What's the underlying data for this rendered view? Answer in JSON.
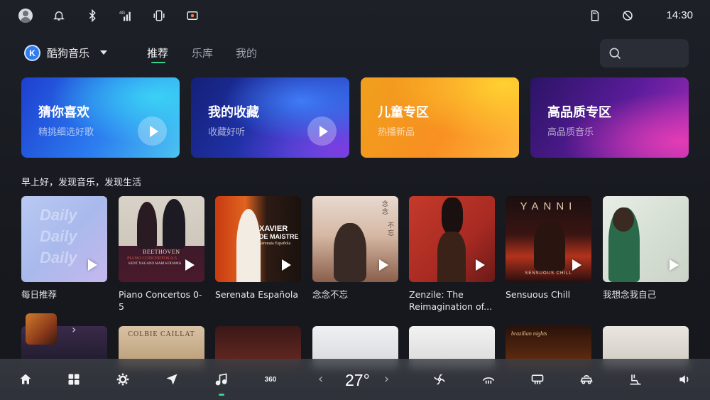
{
  "status_bar": {
    "time": "14:30",
    "icons": [
      "user-avatar",
      "bell-icon",
      "bluetooth-icon",
      "4g-signal-icon",
      "phone-vibrate-icon",
      "record-icon",
      "sd-card-icon",
      "location-off-icon"
    ]
  },
  "header": {
    "app_logo_letter": "K",
    "app_name": "酷狗音乐",
    "tabs": [
      {
        "label": "推荐",
        "active": true
      },
      {
        "label": "乐库",
        "active": false
      },
      {
        "label": "我的",
        "active": false
      }
    ],
    "search_icon": "search-icon"
  },
  "feature_cards": [
    {
      "title": "猜你喜欢",
      "subtitle": "精挑细选好歌",
      "has_play": true
    },
    {
      "title": "我的收藏",
      "subtitle": "收藏好听",
      "has_play": true
    },
    {
      "title": "儿童专区",
      "subtitle": "热播新品",
      "has_play": false
    },
    {
      "title": "高品质专区",
      "subtitle": "高品质音乐",
      "has_play": false
    }
  ],
  "section_title": "早上好，发现音乐，发现生活",
  "albums": [
    {
      "label": "每日推荐",
      "cover_text": [
        "Daily",
        "Daily",
        "Daily"
      ]
    },
    {
      "label": "Piano Concertos 0-5",
      "cover_text": [
        "BEETHOVEN",
        "PIANO CONCERTOS 0-5",
        "KENT NAGANO  MARI KODAMA"
      ]
    },
    {
      "label": "Serenata Española",
      "cover_text": [
        "XAVIER",
        "DE MAISTRE",
        "Serenata Española"
      ]
    },
    {
      "label": "念念不忘",
      "cover_text": [
        "念念",
        "不忘"
      ]
    },
    {
      "label": "Zenzile: The Reimagination of...",
      "cover_text": []
    },
    {
      "label": "Sensuous Chill",
      "cover_text": [
        "YANNI",
        "SENSUOUS CHILL"
      ]
    },
    {
      "label": "我想念我自己",
      "cover_text": []
    }
  ],
  "bottom_row": {
    "covers": [
      "COLBIE CAILLAT",
      "brazilian nights"
    ],
    "expand_chevron": "›"
  },
  "dock": {
    "items": [
      "home-icon",
      "apps-grid-icon",
      "settings-gear-icon",
      "navigation-arrow-icon",
      "music-note-icon",
      "360-camera-icon"
    ],
    "label_360": "360",
    "temperature": "27°",
    "temp_down": "‹",
    "temp_up": "›",
    "climate_items": [
      "ac-fan-icon",
      "front-defrost-icon",
      "rear-defrost-icon",
      "car-recirculation-icon",
      "seat-heat-icon",
      "volume-icon"
    ]
  }
}
